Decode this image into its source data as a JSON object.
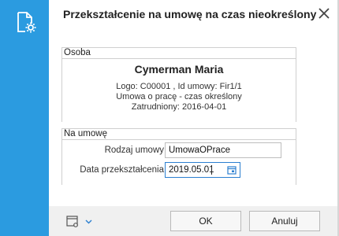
{
  "window": {
    "title": "Przekształcenie na umowę na czas nieokreślony",
    "accent_color": "#2b9be0",
    "sidebar_icon": "document-gear-icon",
    "close_icon": "close-icon"
  },
  "osoba": {
    "header": "Osoba",
    "name": "Cymerman Maria",
    "logo_line": "Logo: C00001 , Id umowy: Fir1/1",
    "contract_line": "Umowa o pracę - czas określony",
    "employed_line": "Zatrudniony: 2016-04-01"
  },
  "na_umowe": {
    "header": "Na umowę",
    "contract_type_label": "Rodzaj umowy",
    "contract_type_value": "UmowaOPrace",
    "conversion_date_label": "Data przekształcenia",
    "conversion_date_value": "2019.05.01",
    "calendar_icon": "calendar-icon"
  },
  "footer": {
    "tool_icon": "window-settings-icon",
    "dropdown_icon": "chevron-down-icon",
    "ok_label": "OK",
    "cancel_label": "Anuluj"
  }
}
